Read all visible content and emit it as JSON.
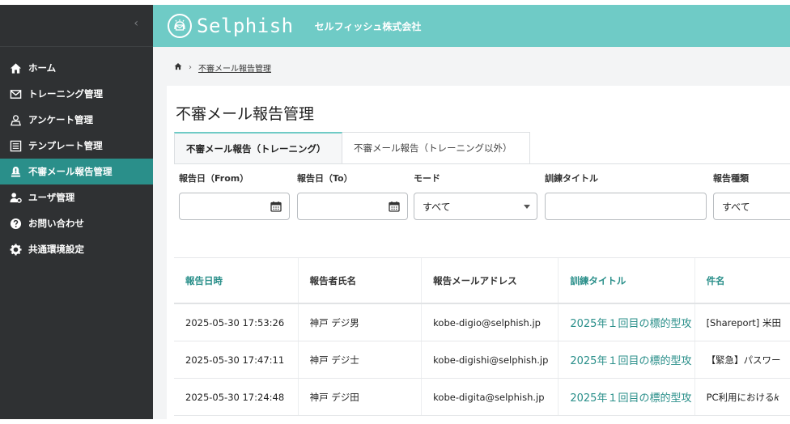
{
  "brand": {
    "logo_text": "Selphish",
    "company": "セルフィッシュ株式会社",
    "accent": "#6fcbc6",
    "accent_dark": "#2a8f8a"
  },
  "sidebar": {
    "collapse_icon": "chevron-left-icon",
    "items": [
      {
        "label": "ホーム",
        "icon": "home-icon"
      },
      {
        "label": "トレーニング管理",
        "icon": "mail-icon"
      },
      {
        "label": "アンケート管理",
        "icon": "survey-icon"
      },
      {
        "label": "テンプレート管理",
        "icon": "template-icon"
      },
      {
        "label": "不審メール報告管理",
        "icon": "alert-person-icon",
        "active": true
      },
      {
        "label": "ユーザ管理",
        "icon": "user-settings-icon"
      },
      {
        "label": "お問い合わせ",
        "icon": "question-icon"
      },
      {
        "label": "共通環境設定",
        "icon": "gear-icon"
      }
    ]
  },
  "breadcrumb": {
    "current": "不審メール報告管理"
  },
  "page": {
    "title": "不審メール報告管理"
  },
  "tabs": [
    {
      "label": "不審メール報告（トレーニング）",
      "active": true
    },
    {
      "label": "不審メール報告（トレーニング以外）",
      "active": false
    }
  ],
  "filters": {
    "from_label": "報告日（From）",
    "to_label": "報告日（To）",
    "mode_label": "モード",
    "mode_value": "すべて",
    "title_label": "訓練タイトル",
    "title_value": "",
    "type_label": "報告種類",
    "type_value": "すべて"
  },
  "table": {
    "columns": [
      "報告日時",
      "報告者氏名",
      "報告メールアドレス",
      "訓練タイトル",
      "件名"
    ],
    "rows": [
      [
        "2025-05-30 17:53:26",
        "神戸 デジ男",
        "kobe-digio@selphish.jp",
        "2025年１回目の標的型攻",
        "[Shareport] 米田"
      ],
      [
        "2025-05-30 17:47:11",
        "神戸 デジ士",
        "kobe-digishi@selphish.jp",
        "2025年１回目の標的型攻",
        "【緊急】パスワー"
      ],
      [
        "2025-05-30 17:24:48",
        "神戸 デジ田",
        "kobe-digita@selphish.jp",
        "2025年１回目の標的型攻",
        "PC利用における𝑘"
      ]
    ]
  }
}
